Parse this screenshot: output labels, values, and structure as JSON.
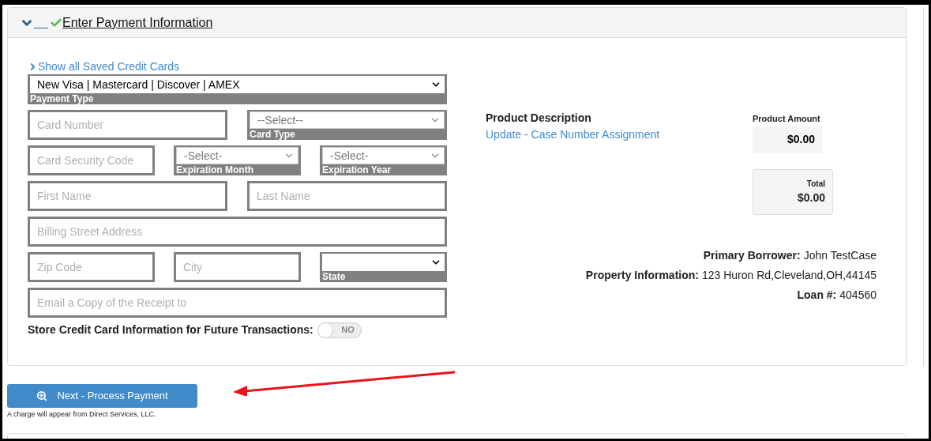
{
  "section": {
    "title": "Enter Payment Information",
    "expanded": true,
    "complete": true
  },
  "saved_cards_link": "Show all Saved Credit Cards",
  "rows": [
    [
      {
        "kind": "select",
        "value": "New Visa | Mastercard | Discover | AMEX",
        "label": "Payment Type",
        "disabled": false
      }
    ],
    [
      {
        "kind": "input",
        "placeholder": "Card Number"
      },
      {
        "kind": "select",
        "value": "--Select--",
        "label": "Card Type",
        "disabled": true
      }
    ],
    [
      {
        "kind": "input",
        "placeholder": "Card Security Code"
      },
      {
        "kind": "select",
        "value": "-Select-",
        "label": "Expiration Month",
        "disabled": true
      },
      {
        "kind": "select",
        "value": "-Select-",
        "label": "Expiration Year",
        "disabled": true
      }
    ],
    [
      {
        "kind": "input",
        "placeholder": "First Name"
      },
      {
        "kind": "input",
        "placeholder": "Last Name"
      }
    ],
    [
      {
        "kind": "input",
        "placeholder": "Billing Street Address"
      }
    ],
    [
      {
        "kind": "input",
        "placeholder": "Zip Code"
      },
      {
        "kind": "input",
        "placeholder": "City"
      },
      {
        "kind": "select",
        "label": "State",
        "disabled": false
      }
    ],
    [
      {
        "kind": "input",
        "placeholder": "Email a Copy of the Receipt to"
      }
    ]
  ],
  "store_card": {
    "label": "Store Credit Card Information for Future Transactions:",
    "text": "NO",
    "on": false
  },
  "product": {
    "description_heading": "Product Description",
    "description": "Update - Case Number Assignment",
    "amount_label": "Product Amount",
    "amount": "$0.00",
    "total_label": "Total",
    "total": "$0.00"
  },
  "details": [
    {
      "label": "Primary Borrower:",
      "value": "John TestCase"
    },
    {
      "label": "Property Information:",
      "value": "123 Huron Rd,Cleveland,OH,44145"
    },
    {
      "label": "Loan #:",
      "value": "404560"
    }
  ],
  "submit_button": "Next - Process Payment",
  "charge_note": "A charge will appear from Direct Services, LLC."
}
